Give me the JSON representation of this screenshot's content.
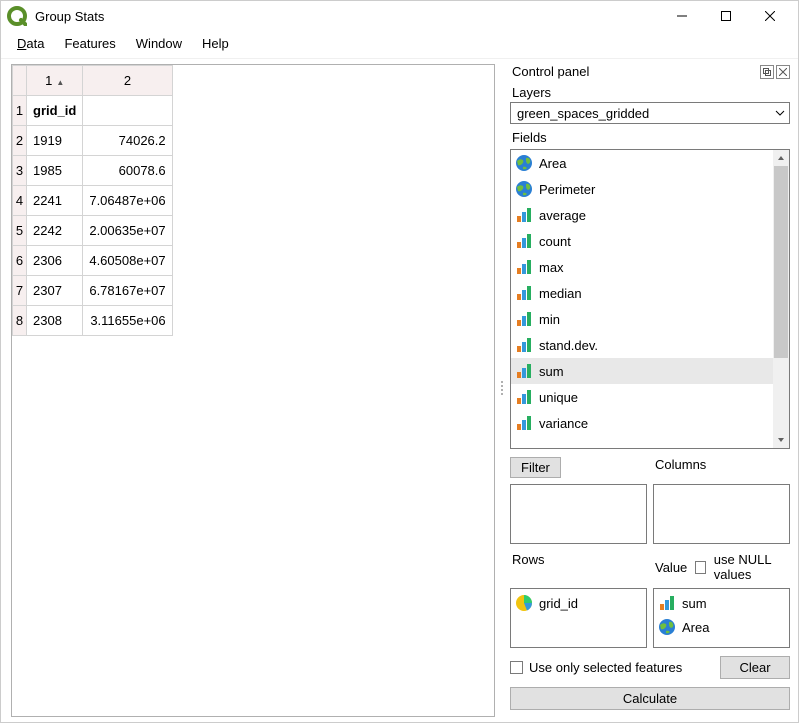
{
  "window": {
    "title": "Group Stats"
  },
  "menubar": {
    "data": "Data",
    "features": "Features",
    "window": "Window",
    "help": "Help"
  },
  "table": {
    "col_headers": [
      "1",
      "2"
    ],
    "row_headers": [
      "1",
      "2",
      "3",
      "4",
      "5",
      "6",
      "7",
      "8"
    ],
    "header_row_label": "grid_id",
    "rows": [
      {
        "c1": "1919",
        "c2": "74026.2"
      },
      {
        "c1": "1985",
        "c2": "60078.6"
      },
      {
        "c1": "2241",
        "c2": "7.06487e+06"
      },
      {
        "c1": "2242",
        "c2": "2.00635e+07"
      },
      {
        "c1": "2306",
        "c2": "4.60508e+07"
      },
      {
        "c1": "2307",
        "c2": "6.78167e+07"
      },
      {
        "c1": "2308",
        "c2": "3.11655e+06"
      }
    ]
  },
  "panel": {
    "title": "Control panel",
    "layers_label": "Layers",
    "layer_selected": "green_spaces_gridded",
    "fields_label": "Fields",
    "fields": [
      {
        "name": "Area",
        "icon": "globe"
      },
      {
        "name": "Perimeter",
        "icon": "globe"
      },
      {
        "name": "average",
        "icon": "bars"
      },
      {
        "name": "count",
        "icon": "bars"
      },
      {
        "name": "max",
        "icon": "bars"
      },
      {
        "name": "median",
        "icon": "bars"
      },
      {
        "name": "min",
        "icon": "bars"
      },
      {
        "name": "stand.dev.",
        "icon": "bars"
      },
      {
        "name": "sum",
        "icon": "bars",
        "selected": true
      },
      {
        "name": "unique",
        "icon": "bars"
      },
      {
        "name": "variance",
        "icon": "bars"
      }
    ],
    "filter_label": "Filter",
    "columns_label": "Columns",
    "rows_label": "Rows",
    "value_label": "Value",
    "use_null_label": "use NULL values",
    "rows_items": [
      {
        "name": "grid_id",
        "icon": "pie"
      }
    ],
    "value_items": [
      {
        "name": "sum",
        "icon": "bars"
      },
      {
        "name": "Area",
        "icon": "globe"
      }
    ],
    "use_selected_label": "Use only selected features",
    "clear_label": "Clear",
    "calculate_label": "Calculate"
  }
}
